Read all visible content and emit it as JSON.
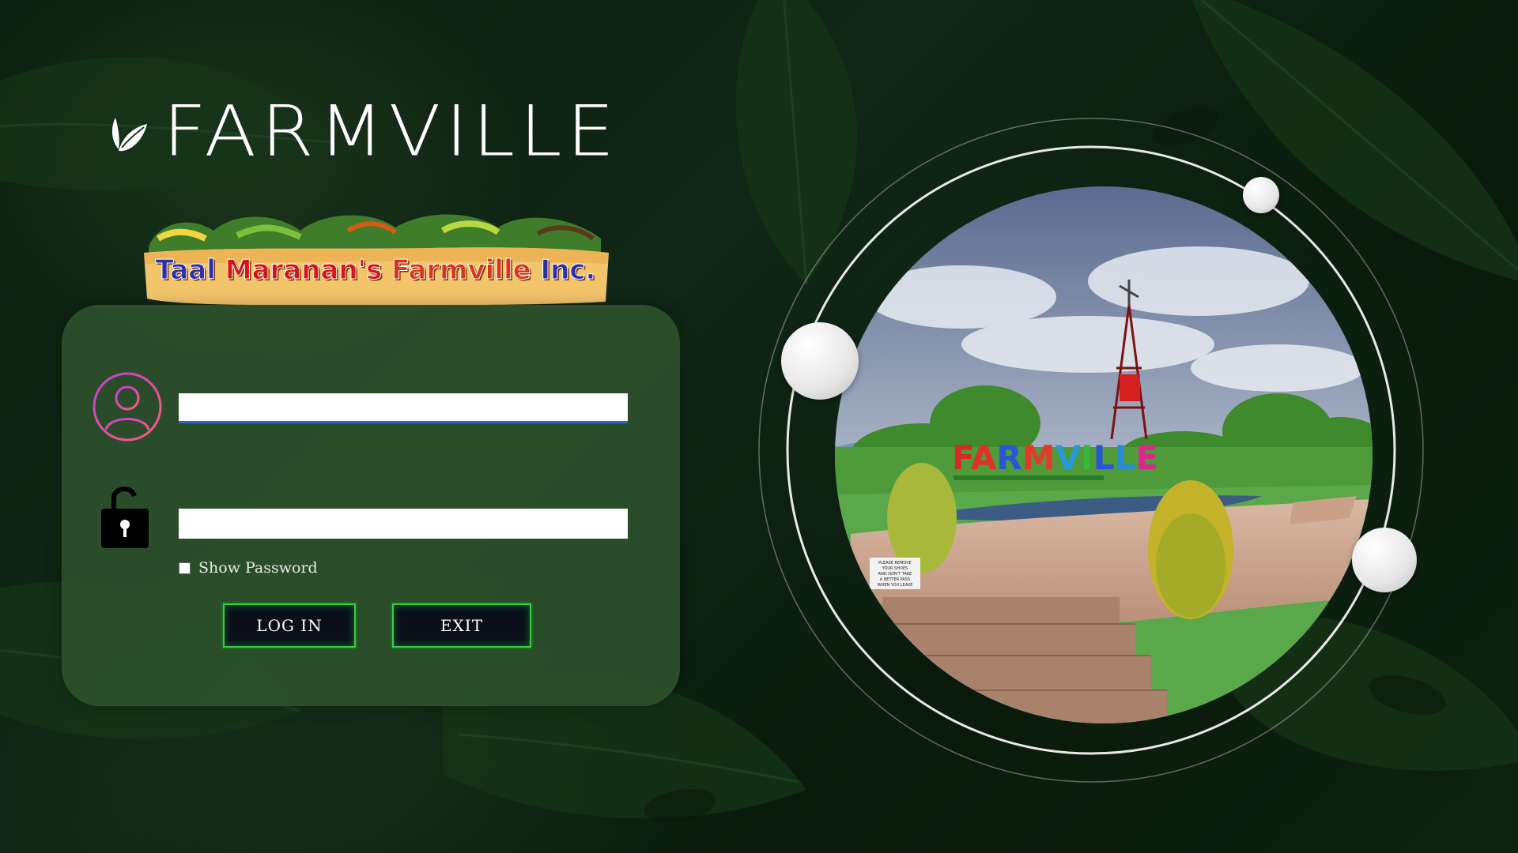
{
  "brand": {
    "title": "FARMVILLE",
    "icon": "leaf-icon"
  },
  "banner": {
    "words": [
      "Taal",
      "Maranan's",
      "Farmville",
      "Inc."
    ]
  },
  "login": {
    "username_value": "",
    "password_value": "",
    "show_password_label": "Show Password",
    "login_label": "LOG IN",
    "exit_label": "EXIT",
    "user_icon": "user-icon",
    "lock_icon": "lock-icon"
  },
  "photo": {
    "sign_letters": [
      "F",
      "A",
      "R",
      "M",
      "V",
      "I",
      "L",
      "L",
      "E"
    ],
    "notice_lines": [
      "PLEASE REMOVE",
      "YOUR SHOES",
      "AND DON'T TAKE",
      "A BETTER PASS",
      "WHEN YOU LEAVE"
    ]
  },
  "colors": {
    "card": "#2e502c",
    "button_glow": "#3ec94a",
    "input_focus": "#2f66c8",
    "user_icon_gradient": [
      "#c23fd6",
      "#ff5b7d"
    ]
  }
}
